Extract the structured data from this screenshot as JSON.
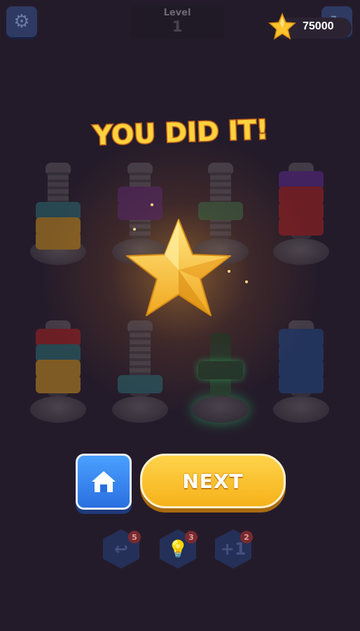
{
  "header": {
    "level_label": "Level",
    "level_value": "1",
    "coins": "75000"
  },
  "title": "YOU DID IT!",
  "buttons": {
    "next_label": "NEXT"
  },
  "powerups": [
    {
      "name": "undo",
      "icon": "undo-icon",
      "count": "5"
    },
    {
      "name": "hint",
      "icon": "lightbulb-icon",
      "count": "3"
    },
    {
      "name": "add-bolt",
      "icon": "add-bolt-icon",
      "count": "2"
    }
  ],
  "colors": {
    "background": "#241b2a",
    "title_yellow": "#ffd23d",
    "next_button": "#f5b21a",
    "home_button": "#2a6fe0",
    "star_gold": "#f7c23a"
  }
}
